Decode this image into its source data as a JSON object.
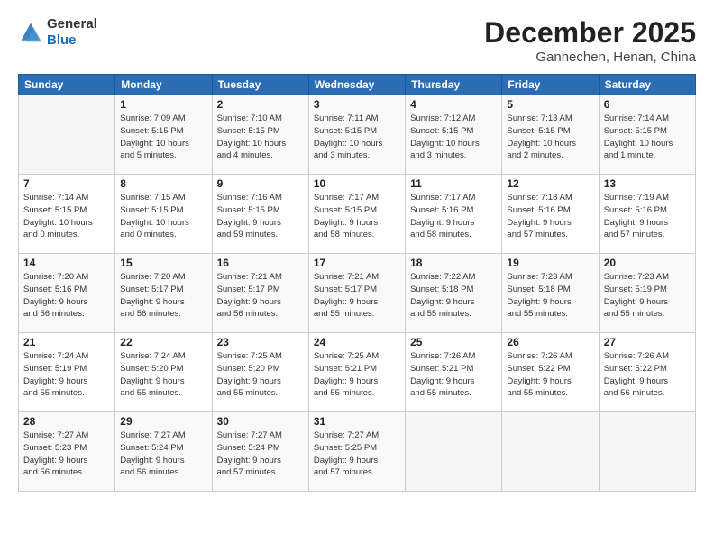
{
  "header": {
    "logo_general": "General",
    "logo_blue": "Blue",
    "month_title": "December 2025",
    "location": "Ganhechen, Henan, China"
  },
  "weekdays": [
    "Sunday",
    "Monday",
    "Tuesday",
    "Wednesday",
    "Thursday",
    "Friday",
    "Saturday"
  ],
  "weeks": [
    [
      {
        "day": "",
        "info": ""
      },
      {
        "day": "1",
        "info": "Sunrise: 7:09 AM\nSunset: 5:15 PM\nDaylight: 10 hours\nand 5 minutes."
      },
      {
        "day": "2",
        "info": "Sunrise: 7:10 AM\nSunset: 5:15 PM\nDaylight: 10 hours\nand 4 minutes."
      },
      {
        "day": "3",
        "info": "Sunrise: 7:11 AM\nSunset: 5:15 PM\nDaylight: 10 hours\nand 3 minutes."
      },
      {
        "day": "4",
        "info": "Sunrise: 7:12 AM\nSunset: 5:15 PM\nDaylight: 10 hours\nand 3 minutes."
      },
      {
        "day": "5",
        "info": "Sunrise: 7:13 AM\nSunset: 5:15 PM\nDaylight: 10 hours\nand 2 minutes."
      },
      {
        "day": "6",
        "info": "Sunrise: 7:14 AM\nSunset: 5:15 PM\nDaylight: 10 hours\nand 1 minute."
      }
    ],
    [
      {
        "day": "7",
        "info": "Sunrise: 7:14 AM\nSunset: 5:15 PM\nDaylight: 10 hours\nand 0 minutes."
      },
      {
        "day": "8",
        "info": "Sunrise: 7:15 AM\nSunset: 5:15 PM\nDaylight: 10 hours\nand 0 minutes."
      },
      {
        "day": "9",
        "info": "Sunrise: 7:16 AM\nSunset: 5:15 PM\nDaylight: 9 hours\nand 59 minutes."
      },
      {
        "day": "10",
        "info": "Sunrise: 7:17 AM\nSunset: 5:15 PM\nDaylight: 9 hours\nand 58 minutes."
      },
      {
        "day": "11",
        "info": "Sunrise: 7:17 AM\nSunset: 5:16 PM\nDaylight: 9 hours\nand 58 minutes."
      },
      {
        "day": "12",
        "info": "Sunrise: 7:18 AM\nSunset: 5:16 PM\nDaylight: 9 hours\nand 57 minutes."
      },
      {
        "day": "13",
        "info": "Sunrise: 7:19 AM\nSunset: 5:16 PM\nDaylight: 9 hours\nand 57 minutes."
      }
    ],
    [
      {
        "day": "14",
        "info": "Sunrise: 7:20 AM\nSunset: 5:16 PM\nDaylight: 9 hours\nand 56 minutes."
      },
      {
        "day": "15",
        "info": "Sunrise: 7:20 AM\nSunset: 5:17 PM\nDaylight: 9 hours\nand 56 minutes."
      },
      {
        "day": "16",
        "info": "Sunrise: 7:21 AM\nSunset: 5:17 PM\nDaylight: 9 hours\nand 56 minutes."
      },
      {
        "day": "17",
        "info": "Sunrise: 7:21 AM\nSunset: 5:17 PM\nDaylight: 9 hours\nand 55 minutes."
      },
      {
        "day": "18",
        "info": "Sunrise: 7:22 AM\nSunset: 5:18 PM\nDaylight: 9 hours\nand 55 minutes."
      },
      {
        "day": "19",
        "info": "Sunrise: 7:23 AM\nSunset: 5:18 PM\nDaylight: 9 hours\nand 55 minutes."
      },
      {
        "day": "20",
        "info": "Sunrise: 7:23 AM\nSunset: 5:19 PM\nDaylight: 9 hours\nand 55 minutes."
      }
    ],
    [
      {
        "day": "21",
        "info": "Sunrise: 7:24 AM\nSunset: 5:19 PM\nDaylight: 9 hours\nand 55 minutes."
      },
      {
        "day": "22",
        "info": "Sunrise: 7:24 AM\nSunset: 5:20 PM\nDaylight: 9 hours\nand 55 minutes."
      },
      {
        "day": "23",
        "info": "Sunrise: 7:25 AM\nSunset: 5:20 PM\nDaylight: 9 hours\nand 55 minutes."
      },
      {
        "day": "24",
        "info": "Sunrise: 7:25 AM\nSunset: 5:21 PM\nDaylight: 9 hours\nand 55 minutes."
      },
      {
        "day": "25",
        "info": "Sunrise: 7:26 AM\nSunset: 5:21 PM\nDaylight: 9 hours\nand 55 minutes."
      },
      {
        "day": "26",
        "info": "Sunrise: 7:26 AM\nSunset: 5:22 PM\nDaylight: 9 hours\nand 55 minutes."
      },
      {
        "day": "27",
        "info": "Sunrise: 7:26 AM\nSunset: 5:22 PM\nDaylight: 9 hours\nand 56 minutes."
      }
    ],
    [
      {
        "day": "28",
        "info": "Sunrise: 7:27 AM\nSunset: 5:23 PM\nDaylight: 9 hours\nand 56 minutes."
      },
      {
        "day": "29",
        "info": "Sunrise: 7:27 AM\nSunset: 5:24 PM\nDaylight: 9 hours\nand 56 minutes."
      },
      {
        "day": "30",
        "info": "Sunrise: 7:27 AM\nSunset: 5:24 PM\nDaylight: 9 hours\nand 57 minutes."
      },
      {
        "day": "31",
        "info": "Sunrise: 7:27 AM\nSunset: 5:25 PM\nDaylight: 9 hours\nand 57 minutes."
      },
      {
        "day": "",
        "info": ""
      },
      {
        "day": "",
        "info": ""
      },
      {
        "day": "",
        "info": ""
      }
    ]
  ]
}
